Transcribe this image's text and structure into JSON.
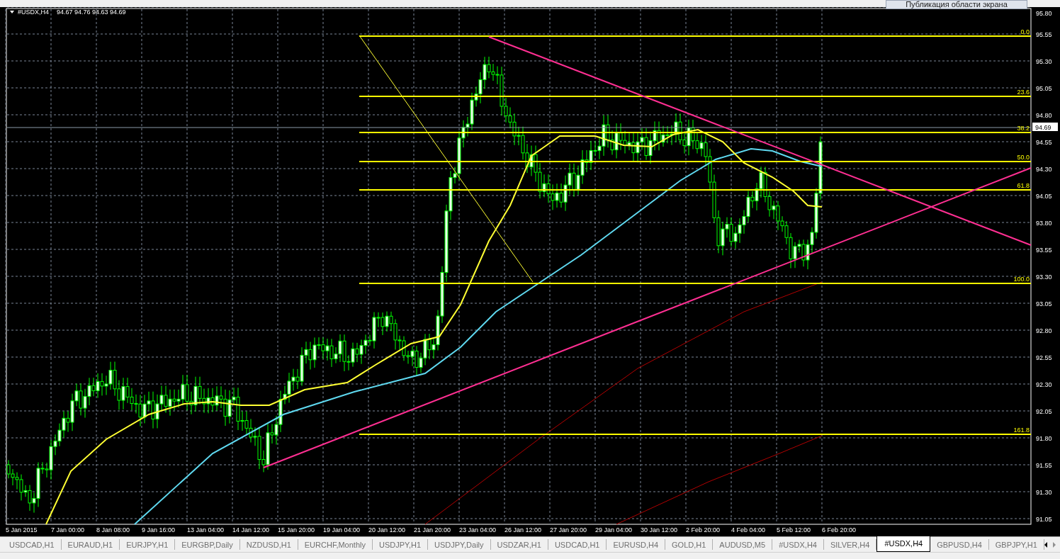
{
  "chart_header": {
    "symbol": "#USDX,H4",
    "ohlc": "94.67 94.76 94.63 94.69"
  },
  "overlay_button": "Публикация области экрана",
  "price_axis": {
    "ticks": [
      "95.80",
      "95.55",
      "95.30",
      "95.05",
      "94.80",
      "94.55",
      "94.30",
      "94.05",
      "93.80",
      "93.55",
      "93.30",
      "93.05",
      "92.80",
      "92.55",
      "92.30",
      "92.05",
      "91.80",
      "91.55",
      "91.30",
      "91.05"
    ],
    "current_price": "94.69"
  },
  "time_axis": {
    "ticks": [
      "5 Jan 2015",
      "7 Jan 00:00",
      "8 Jan 08:00",
      "9 Jan 16:00",
      "13 Jan 04:00",
      "14 Jan 12:00",
      "15 Jan 20:00",
      "19 Jan 04:00",
      "20 Jan 12:00",
      "21 Jan 20:00",
      "23 Jan 04:00",
      "26 Jan 12:00",
      "27 Jan 20:00",
      "29 Jan 04:00",
      "30 Jan 12:00",
      "2 Feb 20:00",
      "4 Feb 04:00",
      "5 Feb 12:00",
      "6 Feb 20:00"
    ]
  },
  "fibonacci_levels": [
    "0.0",
    "23.6",
    "38.2",
    "50.0",
    "61.8",
    "100.0",
    "161.8"
  ],
  "tabs": [
    {
      "label": "USDCAD,H1",
      "selected": false
    },
    {
      "label": "EURAUD,H1",
      "selected": false
    },
    {
      "label": "EURJPY,H1",
      "selected": false
    },
    {
      "label": "EURGBP,Daily",
      "selected": false
    },
    {
      "label": "NZDUSD,H1",
      "selected": false
    },
    {
      "label": "EURCHF,Monthly",
      "selected": false
    },
    {
      "label": "USDJPY,H1",
      "selected": false
    },
    {
      "label": "USDJPY,Daily",
      "selected": false
    },
    {
      "label": "USDZAR,H1",
      "selected": false
    },
    {
      "label": "USDCAD,H1",
      "selected": false
    },
    {
      "label": "EURUSD,H4",
      "selected": false
    },
    {
      "label": "GOLD,H1",
      "selected": false
    },
    {
      "label": "AUDUSD,M5",
      "selected": false
    },
    {
      "label": "#USDX,H4",
      "selected": false
    },
    {
      "label": "SILVER,H4",
      "selected": false
    },
    {
      "label": "#USDX,H4",
      "selected": true
    },
    {
      "label": "GBPUSD,H4",
      "selected": false
    },
    {
      "label": "GBPJPY,H1",
      "selected": false
    }
  ]
}
